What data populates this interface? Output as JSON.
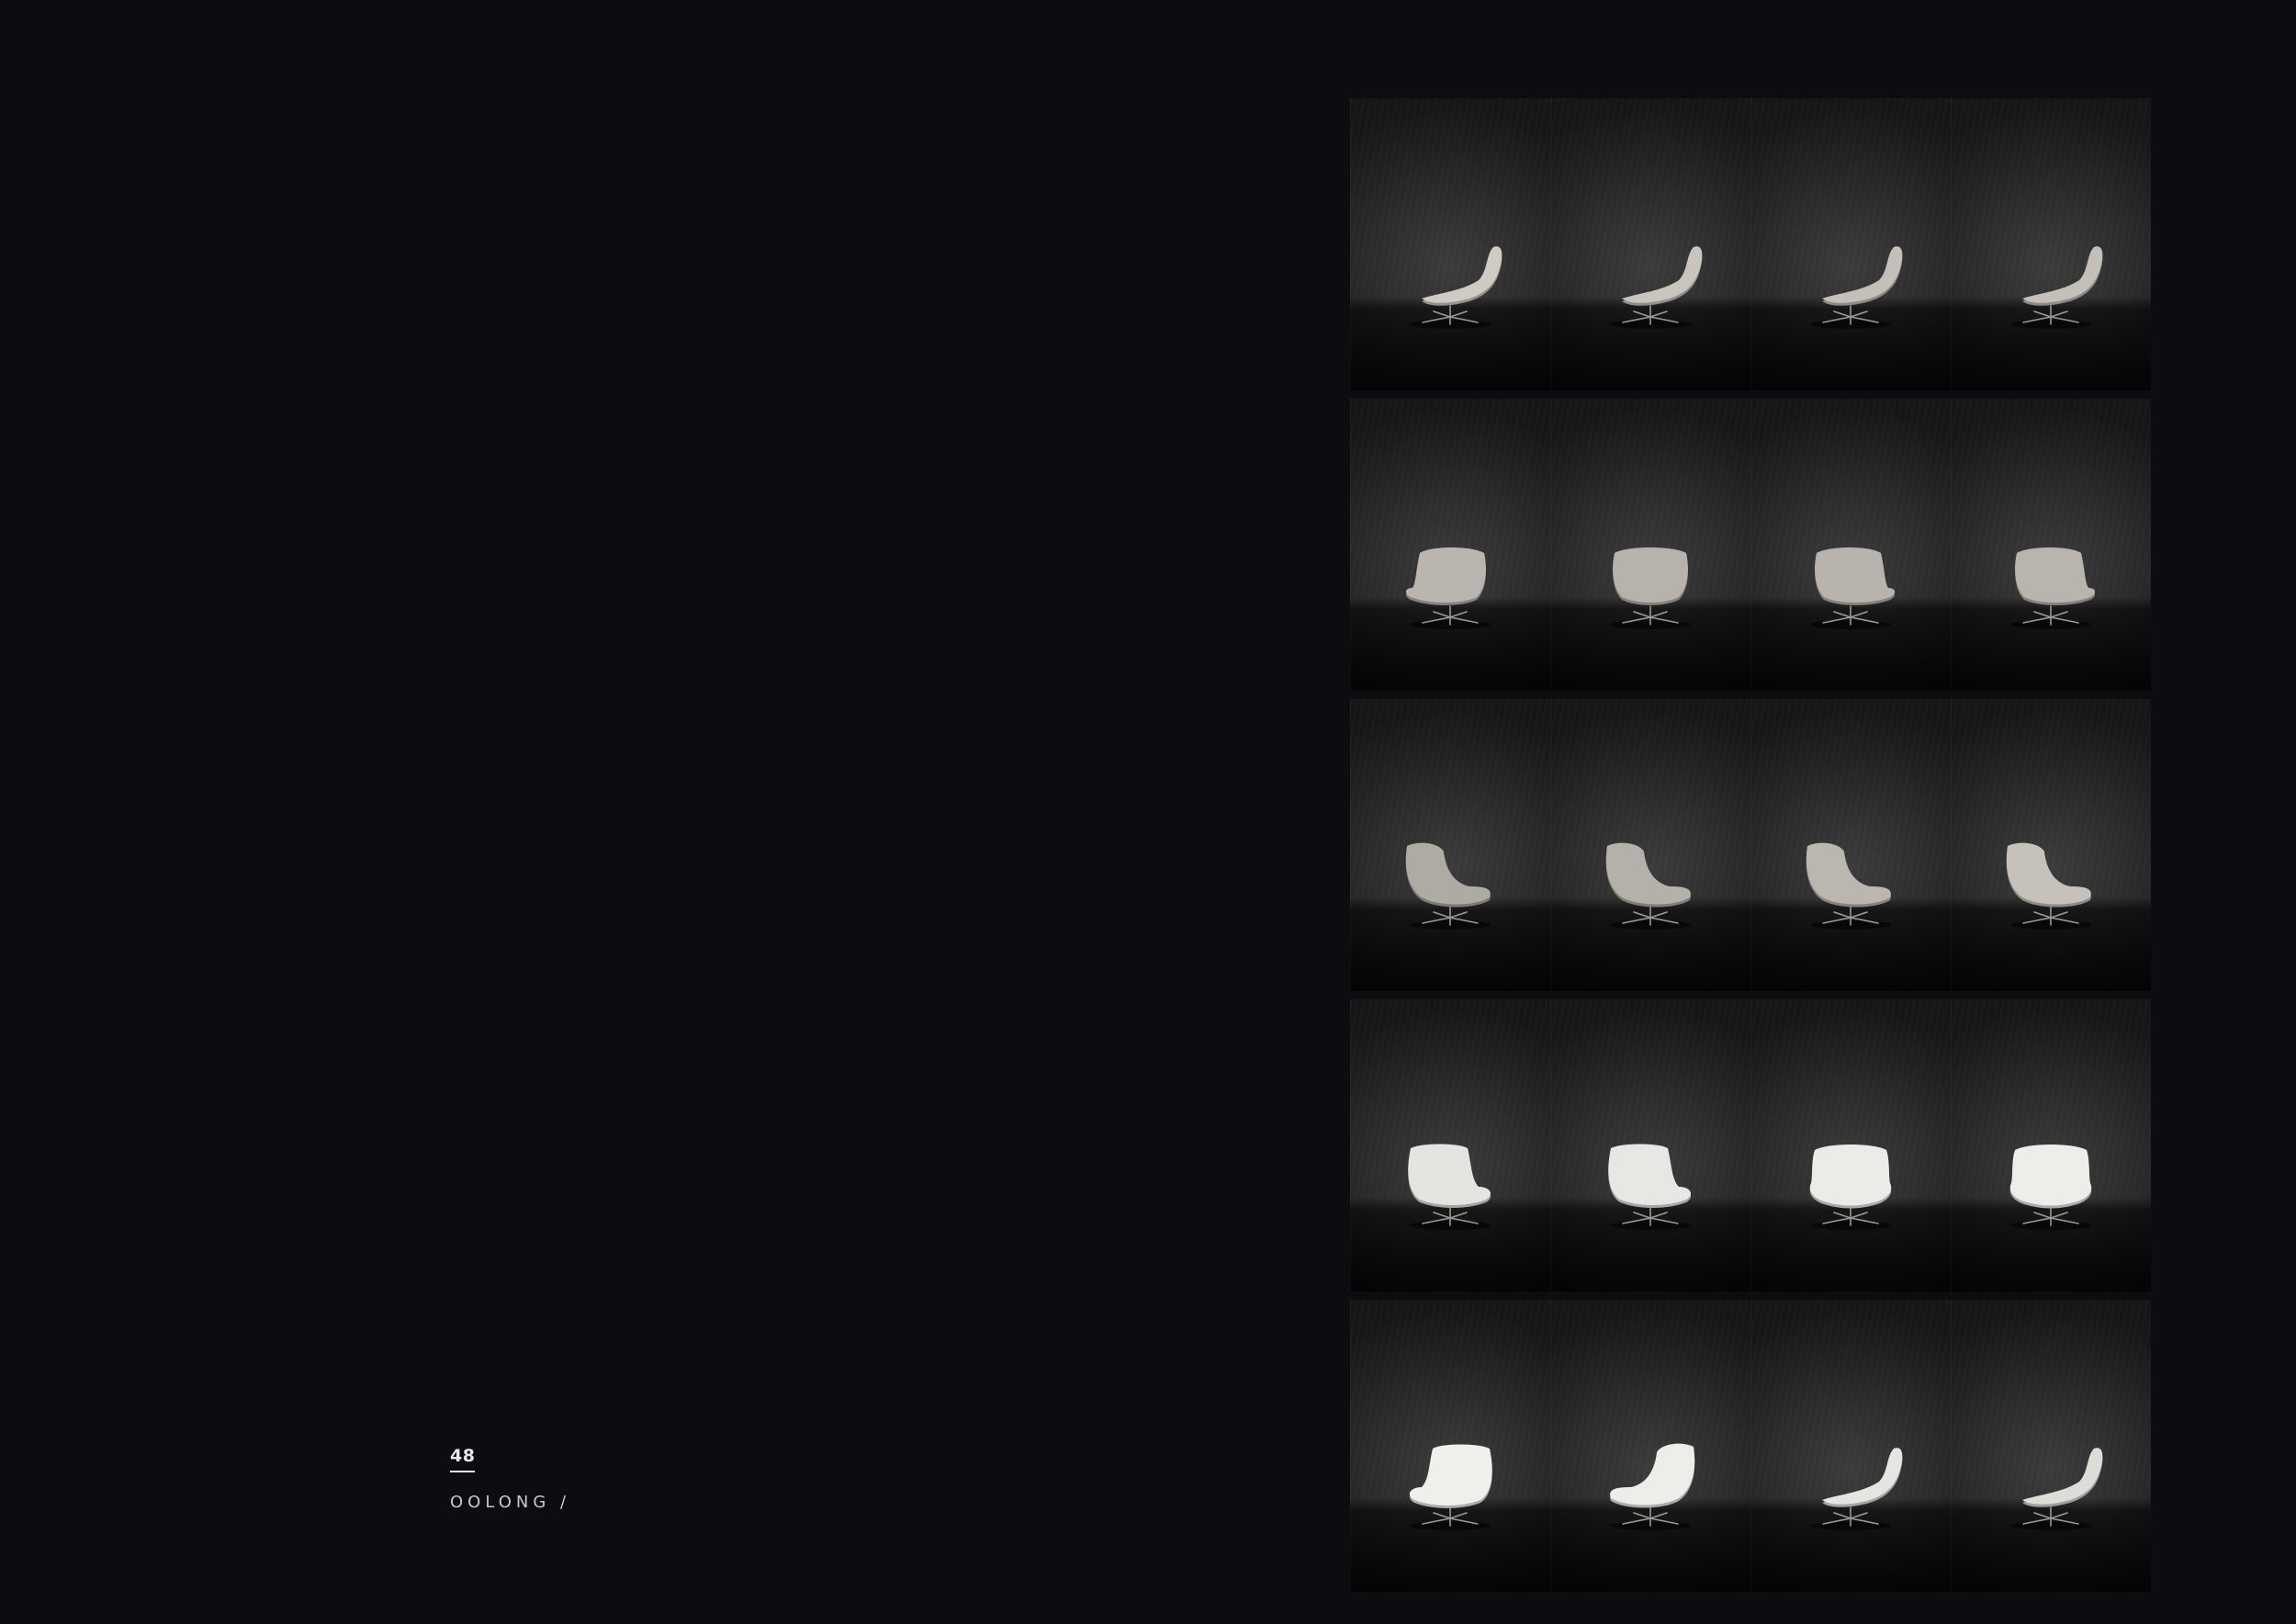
{
  "page": {
    "number": "48",
    "collection": "OOLONG /"
  },
  "grid": {
    "rows": [
      [
        "chair-right-profile",
        "chair-right-three-quarter-back",
        "chair-back-right",
        "chair-back-left"
      ],
      [
        "chair-back-turning",
        "chair-back",
        "chair-back-right-turn",
        "chair-back-left-turn"
      ],
      [
        "chair-left-three-quarter",
        "chair-left-profile",
        "chair-left-side",
        "chair-left-front"
      ],
      [
        "chair-front-left",
        "chair-front-slight-left",
        "chair-front-slight-right",
        "chair-front"
      ],
      [
        "chair-front-right",
        "chair-right-three-quarter-front",
        "chair-right-side",
        "chair-right-profile-end"
      ]
    ],
    "tones": [
      [
        "#cfcbc4",
        "#c9c5be",
        "#c4c0b9",
        "#c4c0b9"
      ],
      [
        "#bab6af",
        "#b7b3ac",
        "#b8b4ad",
        "#b9b5ae"
      ],
      [
        "#aeaaa4",
        "#b4b0aa",
        "#bbb7b0",
        "#c6c2bb"
      ],
      [
        "#e6e4e0",
        "#e9e7e3",
        "#ecebe7",
        "#eeede9"
      ],
      [
        "#f0efeb",
        "#eeede9",
        "#e7e5e1",
        "#dedcd7"
      ]
    ]
  }
}
